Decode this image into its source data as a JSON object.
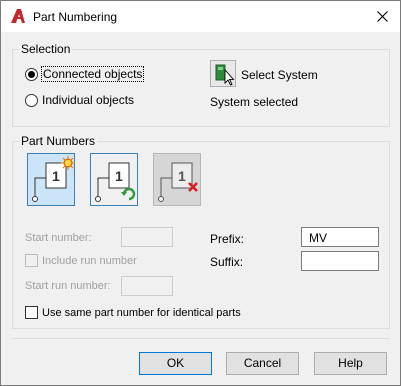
{
  "window": {
    "title": "Part Numbering",
    "app_icon": "autocad-a-icon",
    "close_icon": "close-x-icon"
  },
  "selection": {
    "group_label": "Selection",
    "options": [
      {
        "label": "Connected objects",
        "checked": true
      },
      {
        "label": "Individual objects",
        "checked": false
      }
    ],
    "select_system_label": "Select System",
    "status": "System selected"
  },
  "part_numbers": {
    "group_label": "Part Numbers",
    "mode_buttons": [
      {
        "icon": "new-number-icon",
        "badge": "1",
        "state": "active"
      },
      {
        "icon": "renumber-icon",
        "badge": "1",
        "state": "normal"
      },
      {
        "icon": "delete-number-icon",
        "badge": "1",
        "state": "disabled"
      }
    ],
    "start_number_label": "Start number:",
    "start_number_value": "",
    "include_run_label": "Include run number",
    "include_run_checked": false,
    "start_run_label": "Start run number:",
    "start_run_value": "",
    "prefix_label": "Prefix:",
    "prefix_value": "MV",
    "suffix_label": "Suffix:",
    "suffix_value": "",
    "same_part_label": "Use same part number for identical parts",
    "same_part_checked": false
  },
  "buttons": {
    "ok": "OK",
    "cancel": "Cancel",
    "help": "Help"
  },
  "colors": {
    "accent": "#0078d7",
    "active_button_bg": "#cce4f7",
    "app_icon_red": "#c1272d"
  }
}
